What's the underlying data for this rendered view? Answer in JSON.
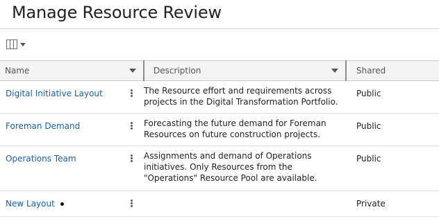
{
  "page": {
    "title": "Manage Resource Review"
  },
  "toolbar": {
    "column_picker_icon": "columns-icon"
  },
  "table": {
    "columns": [
      {
        "label": "Name",
        "sortable": true
      },
      {
        "label": "Description",
        "sortable": true
      },
      {
        "label": "Shared",
        "sortable": false
      }
    ],
    "rows": [
      {
        "name": "Digital Initiative Layout",
        "description": [
          "The Resource effort and requirements across",
          "projects in the Digital Transformation Portfolio."
        ],
        "shared": "Public",
        "modified": false
      },
      {
        "name": "Foreman Demand",
        "description": [
          "Forecasting the future demand for Foreman",
          "Resources on future construction projects."
        ],
        "shared": "Public",
        "modified": false
      },
      {
        "name": "Operations Team",
        "description": [
          "Assignments and demand of Operations",
          "initiatives. Only Resources from the",
          "\"Operations\" Resource Pool are available."
        ],
        "shared": "Public",
        "modified": false
      },
      {
        "name": "New Layout",
        "description": [],
        "shared": "Private",
        "modified": true
      }
    ]
  },
  "colors": {
    "link": "#1a5fa3",
    "header_bg": "#f4f4f4",
    "text": "#222222"
  }
}
